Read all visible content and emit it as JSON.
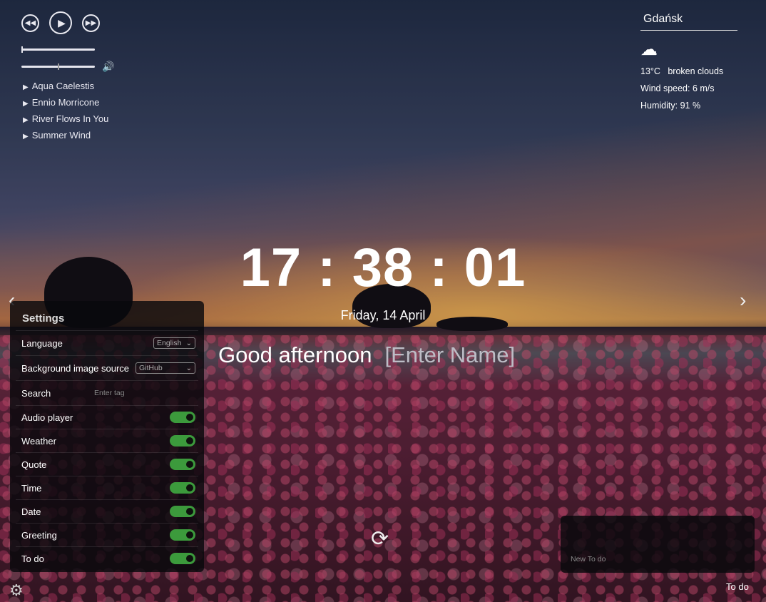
{
  "player": {
    "prev_icon": "rewind-icon",
    "play_icon": "play-icon",
    "next_icon": "fast-forward-icon",
    "progress": 0.0,
    "volume": 0.5,
    "volume_icon": "speaker-icon",
    "playlist": [
      "Aqua Caelestis",
      "Ennio Morricone",
      "River Flows In You",
      "Summer Wind"
    ]
  },
  "weather": {
    "city": "Gdańsk",
    "icon": "broken-clouds-icon",
    "temp": "13°C",
    "description": "broken clouds",
    "wind": "Wind speed: 6 m/s",
    "humidity": "Humidity: 91 %"
  },
  "clock": {
    "time": "17 : 38 : 01",
    "date": "Friday, 14 April"
  },
  "greeting": {
    "text": "Good afternoon",
    "name_placeholder": "[Enter Name]"
  },
  "settings": {
    "title": "Settings",
    "language_label": "Language",
    "language_value": "English",
    "bg_source_label": "Background image source",
    "bg_source_value": "GitHub",
    "search_label": "Search",
    "search_placeholder": "Enter tag",
    "toggles": [
      {
        "label": "Audio player",
        "on": true
      },
      {
        "label": "Weather",
        "on": true
      },
      {
        "label": "Quote",
        "on": true
      },
      {
        "label": "Time",
        "on": true
      },
      {
        "label": "Date",
        "on": true
      },
      {
        "label": "Greeting",
        "on": true
      },
      {
        "label": "To do",
        "on": true
      }
    ]
  },
  "todo": {
    "placeholder": "New To do",
    "button_label": "To do"
  },
  "colors": {
    "toggle_on": "#3c9a3c",
    "panel_bg": "#08080c"
  }
}
